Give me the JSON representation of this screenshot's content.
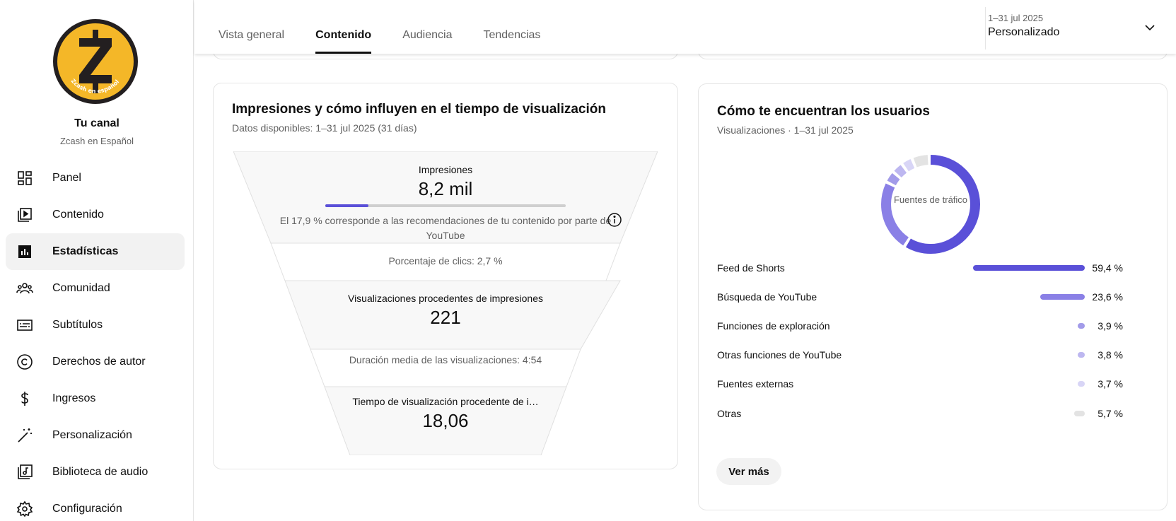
{
  "sidebar": {
    "channel_title": "Tu canal",
    "channel_name": "Zcash en Español",
    "logo_text": "Zcash en español",
    "items": [
      {
        "label": "Panel",
        "icon": "dashboard-icon"
      },
      {
        "label": "Contenido",
        "icon": "content-icon"
      },
      {
        "label": "Estadísticas",
        "icon": "analytics-icon",
        "active": true
      },
      {
        "label": "Comunidad",
        "icon": "community-icon"
      },
      {
        "label": "Subtítulos",
        "icon": "subtitles-icon"
      },
      {
        "label": "Derechos de autor",
        "icon": "copyright-icon"
      },
      {
        "label": "Ingresos",
        "icon": "dollar-icon"
      },
      {
        "label": "Personalización",
        "icon": "magic-wand-icon"
      },
      {
        "label": "Biblioteca de audio",
        "icon": "audio-library-icon"
      },
      {
        "label": "Configuración",
        "icon": "gear-icon"
      }
    ]
  },
  "header": {
    "tabs": [
      {
        "label": "Vista general"
      },
      {
        "label": "Contenido",
        "active": true
      },
      {
        "label": "Audiencia"
      },
      {
        "label": "Tendencias"
      }
    ],
    "date_range": "1–31 jul 2025",
    "date_preset": "Personalizado"
  },
  "impressions": {
    "title": "Impresiones y cómo influyen en el tiempo de visualización",
    "subtitle": "Datos disponibles: 1–31 jul 2025 (31 días)",
    "impressions_label": "Impresiones",
    "impressions_value": "8,2 mil",
    "recommend_fraction": 0.179,
    "recommend_note": "El 17,9 % corresponde a las recomendaciones de tu contenido por parte de YouTube",
    "ctr_label": "Porcentaje de clics: 2,7 %",
    "views_label": "Visualizaciones procedentes de impresiones",
    "views_value": "221",
    "avg_duration_label": "Duración media de las visualizaciones: 4:54",
    "watch_time_label": "Tiempo de visualización procedente de i…",
    "watch_time_value": "18,06"
  },
  "traffic": {
    "title": "Cómo te encuentran los usuarios",
    "subtitle": "Visualizaciones · 1–31 jul 2025",
    "donut_center": "Fuentes de tráfico",
    "more_button": "Ver más",
    "colors": {
      "primary": "#5a50d8",
      "secondary": "#8a80e6",
      "tertiary": "#b0a9ee",
      "quaternary": "#c7c2f3",
      "light": "#dcd9f7",
      "gray": "#e3e3e3"
    },
    "sources": [
      {
        "name": "Feed de Shorts",
        "percent": 59.4,
        "label": "59,4 %",
        "color": "#5a50d8"
      },
      {
        "name": "Búsqueda de YouTube",
        "percent": 23.6,
        "label": "23,6 %",
        "color": "#8a80e6"
      },
      {
        "name": "Funciones de exploración",
        "percent": 3.9,
        "label": "3,9 %",
        "color": "#a29be9"
      },
      {
        "name": "Otras funciones de YouTube",
        "percent": 3.8,
        "label": "3,8 %",
        "color": "#bdb7f0"
      },
      {
        "name": "Fuentes externas",
        "percent": 3.7,
        "label": "3,7 %",
        "color": "#d8d5f6"
      },
      {
        "name": "Otras",
        "percent": 5.7,
        "label": "5,7 %",
        "color": "#e3e3e3"
      }
    ]
  }
}
